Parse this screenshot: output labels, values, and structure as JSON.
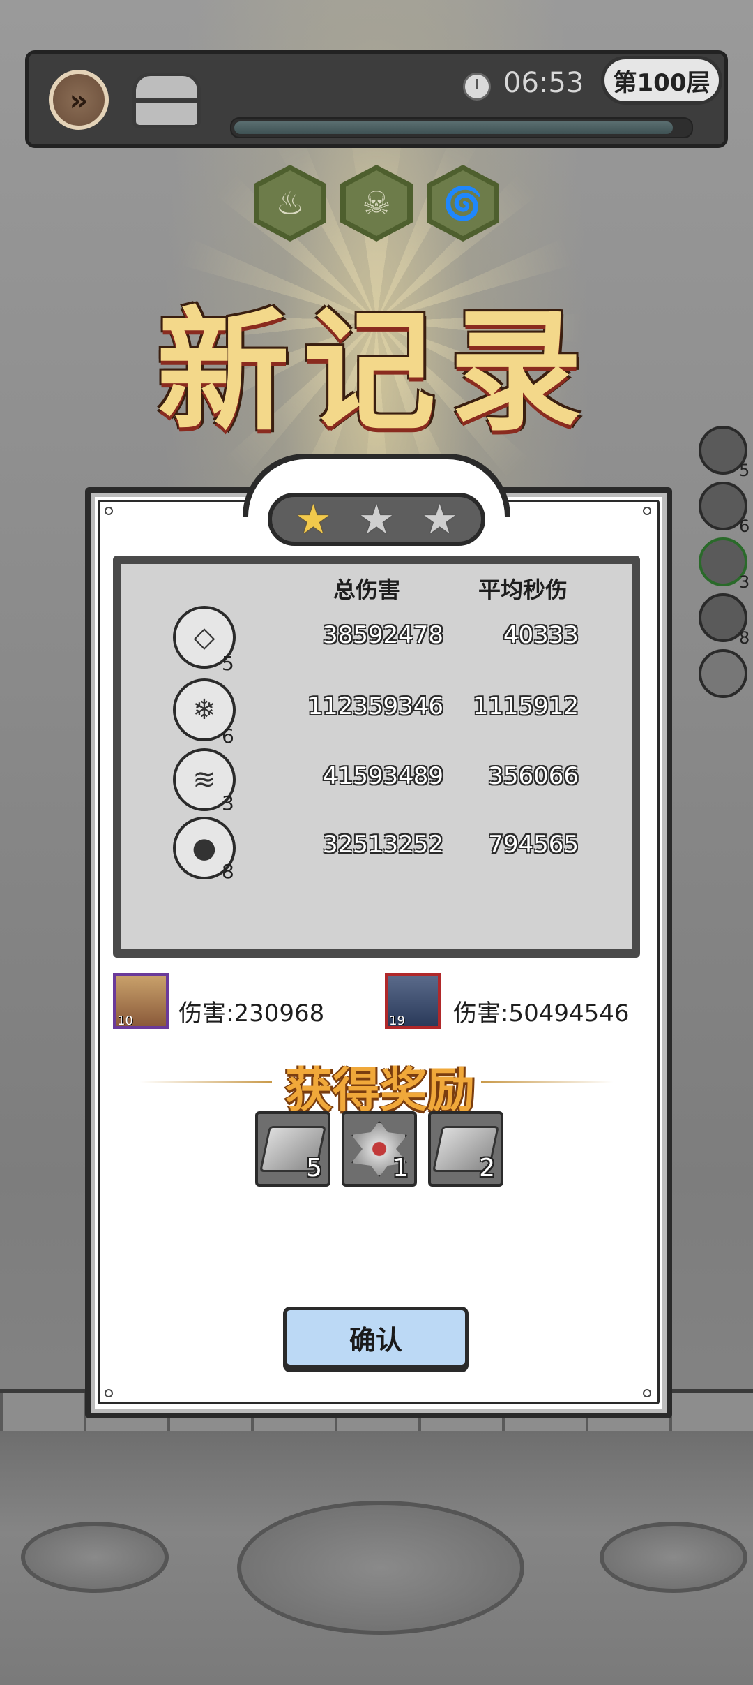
{
  "topbar": {
    "timer": "06:53",
    "level": "第100层",
    "progress_fraction": 0.97,
    "fast_forward_icon": "fast-forward-icon",
    "chest_icon": "chest-icon"
  },
  "debuffs": [
    "fire-down-icon",
    "winged-skull-icon",
    "tornado-down-icon"
  ],
  "headline": "新记录",
  "stars": {
    "earned": 1,
    "total": 3
  },
  "stats": {
    "header_total": "总伤害",
    "header_dps": "平均秒伤",
    "rows": [
      {
        "icon": "crystal-block-icon",
        "level": "5",
        "total": "38592478",
        "dps": "40333"
      },
      {
        "icon": "ice-crystals-icon",
        "level": "6",
        "total": "112359346",
        "dps": "1115912"
      },
      {
        "icon": "spiral-drill-icon",
        "level": "3",
        "total": "41593489",
        "dps": "356066"
      },
      {
        "icon": "bomb-icon",
        "level": "8",
        "total": "32513252",
        "dps": "794565"
      }
    ]
  },
  "heroes": [
    {
      "level": "10",
      "damage_text": "伤害:230968",
      "frame_color": "#6a3a9a"
    },
    {
      "level": "19",
      "damage_text": "伤害:50494546",
      "frame_color": "#b0282a"
    }
  ],
  "rewards": {
    "title": "获得奖励",
    "items": [
      {
        "icon": "silver-ore-icon",
        "count": "5"
      },
      {
        "icon": "gear-ore-icon",
        "count": "1"
      },
      {
        "icon": "silver-ore-icon",
        "count": "2"
      }
    ]
  },
  "confirm_label": "确认",
  "side_skills": [
    "5",
    "6",
    "3",
    "8"
  ]
}
